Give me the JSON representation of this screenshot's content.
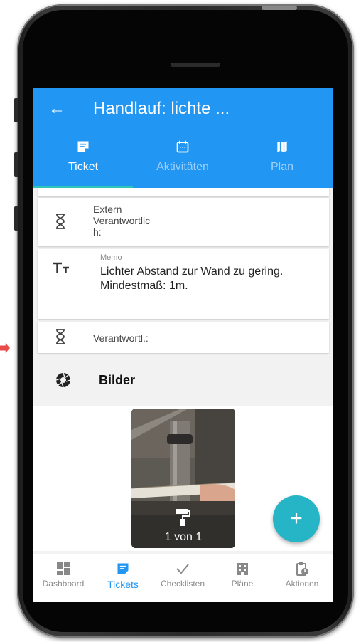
{
  "header": {
    "back_label": "←",
    "title": "Handlauf:  lichte ..."
  },
  "tabs": [
    {
      "label": "Ticket",
      "icon": "ticket-icon",
      "active": true
    },
    {
      "label": "Aktivitäten",
      "icon": "calendar-icon",
      "active": false
    },
    {
      "label": "Plan",
      "icon": "map-icon",
      "active": false
    }
  ],
  "fields": {
    "extern": {
      "label": "Extern\nVerantwortlic\nh:",
      "icon": "hourglass-icon"
    },
    "memo": {
      "label": "Memo",
      "value": "Lichter Abstand zur Wand zu gering. Mindestmaß: 1m.",
      "icon": "text-size-icon"
    },
    "verantwortl": {
      "label": "Verantwortl.:",
      "icon": "hourglass-icon"
    }
  },
  "section": {
    "title": "Bilder",
    "icon": "aperture-icon"
  },
  "gallery": {
    "counter": "1 von 1",
    "icon": "paint-roller-icon"
  },
  "fab": {
    "label": "+"
  },
  "bottom_nav": [
    {
      "label": "Dashboard",
      "icon": "dashboard-icon",
      "active": false
    },
    {
      "label": "Tickets",
      "icon": "ticket-icon",
      "active": true
    },
    {
      "label": "Checklisten",
      "icon": "check-icon",
      "active": false
    },
    {
      "label": "Pläne",
      "icon": "building-icon",
      "active": false
    },
    {
      "label": "Aktionen",
      "icon": "clipboard-clock-icon",
      "active": false
    }
  ],
  "colors": {
    "primary": "#2196f3",
    "accent": "#26b5c6",
    "tab_indicator": "#2ec4b6"
  }
}
